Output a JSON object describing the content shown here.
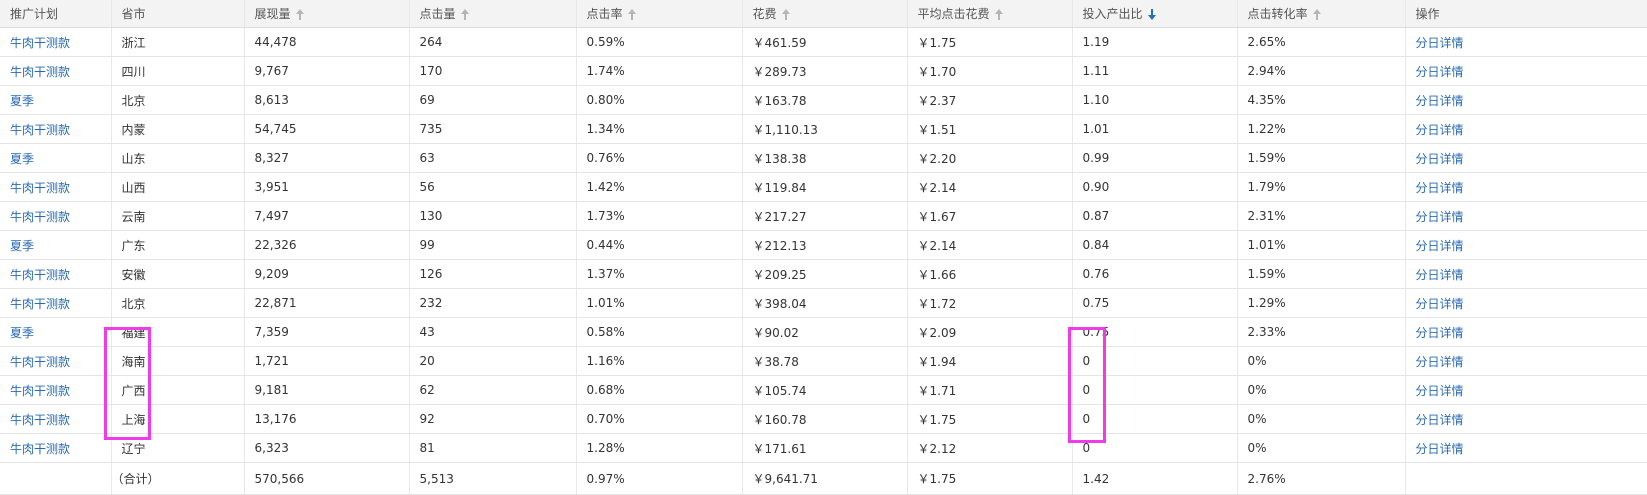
{
  "columns": [
    {
      "label": "推广计划",
      "sort": "none"
    },
    {
      "label": "省市",
      "sort": "none"
    },
    {
      "label": "展现量",
      "sort": "inactive"
    },
    {
      "label": "点击量",
      "sort": "inactive"
    },
    {
      "label": "点击率",
      "sort": "inactive"
    },
    {
      "label": "花费",
      "sort": "inactive"
    },
    {
      "label": "平均点击花费",
      "sort": "inactive"
    },
    {
      "label": "投入产出比",
      "sort": "active-desc"
    },
    {
      "label": "点击转化率",
      "sort": "inactive"
    },
    {
      "label": "操作",
      "sort": "none"
    }
  ],
  "rows": [
    [
      "牛肉干测款",
      "浙江",
      "44,478",
      "264",
      "0.59%",
      "￥461.59",
      "￥1.75",
      "1.19",
      "2.65%",
      "分日详情"
    ],
    [
      "牛肉干测款",
      "四川",
      "9,767",
      "170",
      "1.74%",
      "￥289.73",
      "￥1.70",
      "1.11",
      "2.94%",
      "分日详情"
    ],
    [
      "夏季",
      "北京",
      "8,613",
      "69",
      "0.80%",
      "￥163.78",
      "￥2.37",
      "1.10",
      "4.35%",
      "分日详情"
    ],
    [
      "牛肉干测款",
      "内蒙",
      "54,745",
      "735",
      "1.34%",
      "￥1,110.13",
      "￥1.51",
      "1.01",
      "1.22%",
      "分日详情"
    ],
    [
      "夏季",
      "山东",
      "8,327",
      "63",
      "0.76%",
      "￥138.38",
      "￥2.20",
      "0.99",
      "1.59%",
      "分日详情"
    ],
    [
      "牛肉干测款",
      "山西",
      "3,951",
      "56",
      "1.42%",
      "￥119.84",
      "￥2.14",
      "0.90",
      "1.79%",
      "分日详情"
    ],
    [
      "牛肉干测款",
      "云南",
      "7,497",
      "130",
      "1.73%",
      "￥217.27",
      "￥1.67",
      "0.87",
      "2.31%",
      "分日详情"
    ],
    [
      "夏季",
      "广东",
      "22,326",
      "99",
      "0.44%",
      "￥212.13",
      "￥2.14",
      "0.84",
      "1.01%",
      "分日详情"
    ],
    [
      "牛肉干测款",
      "安徽",
      "9,209",
      "126",
      "1.37%",
      "￥209.25",
      "￥1.66",
      "0.76",
      "1.59%",
      "分日详情"
    ],
    [
      "牛肉干测款",
      "北京",
      "22,871",
      "232",
      "1.01%",
      "￥398.04",
      "￥1.72",
      "0.75",
      "1.29%",
      "分日详情"
    ],
    [
      "夏季",
      "福建",
      "7,359",
      "43",
      "0.58%",
      "￥90.02",
      "￥2.09",
      "0.75",
      "2.33%",
      "分日详情"
    ],
    [
      "牛肉干测款",
      "海南",
      "1,721",
      "20",
      "1.16%",
      "￥38.78",
      "￥1.94",
      "0",
      "0%",
      "分日详情"
    ],
    [
      "牛肉干测款",
      "广西",
      "9,181",
      "62",
      "0.68%",
      "￥105.74",
      "￥1.71",
      "0",
      "0%",
      "分日详情"
    ],
    [
      "牛肉干测款",
      "上海",
      "13,176",
      "92",
      "0.70%",
      "￥160.78",
      "￥1.75",
      "0",
      "0%",
      "分日详情"
    ],
    [
      "牛肉干测款",
      "辽宁",
      "6,323",
      "81",
      "1.28%",
      "￥171.61",
      "￥2.12",
      "0",
      "0%",
      "分日详情"
    ]
  ],
  "total": {
    "label": "（合计）",
    "values": [
      "570,566",
      "5,513",
      "0.97%",
      "￥9,641.71",
      "￥1.75",
      "1.42",
      "2.76%"
    ]
  },
  "annotation_color": "#f03ce8",
  "link_color": "#2a6ab5",
  "sort_active_color": "#1f6fc6"
}
